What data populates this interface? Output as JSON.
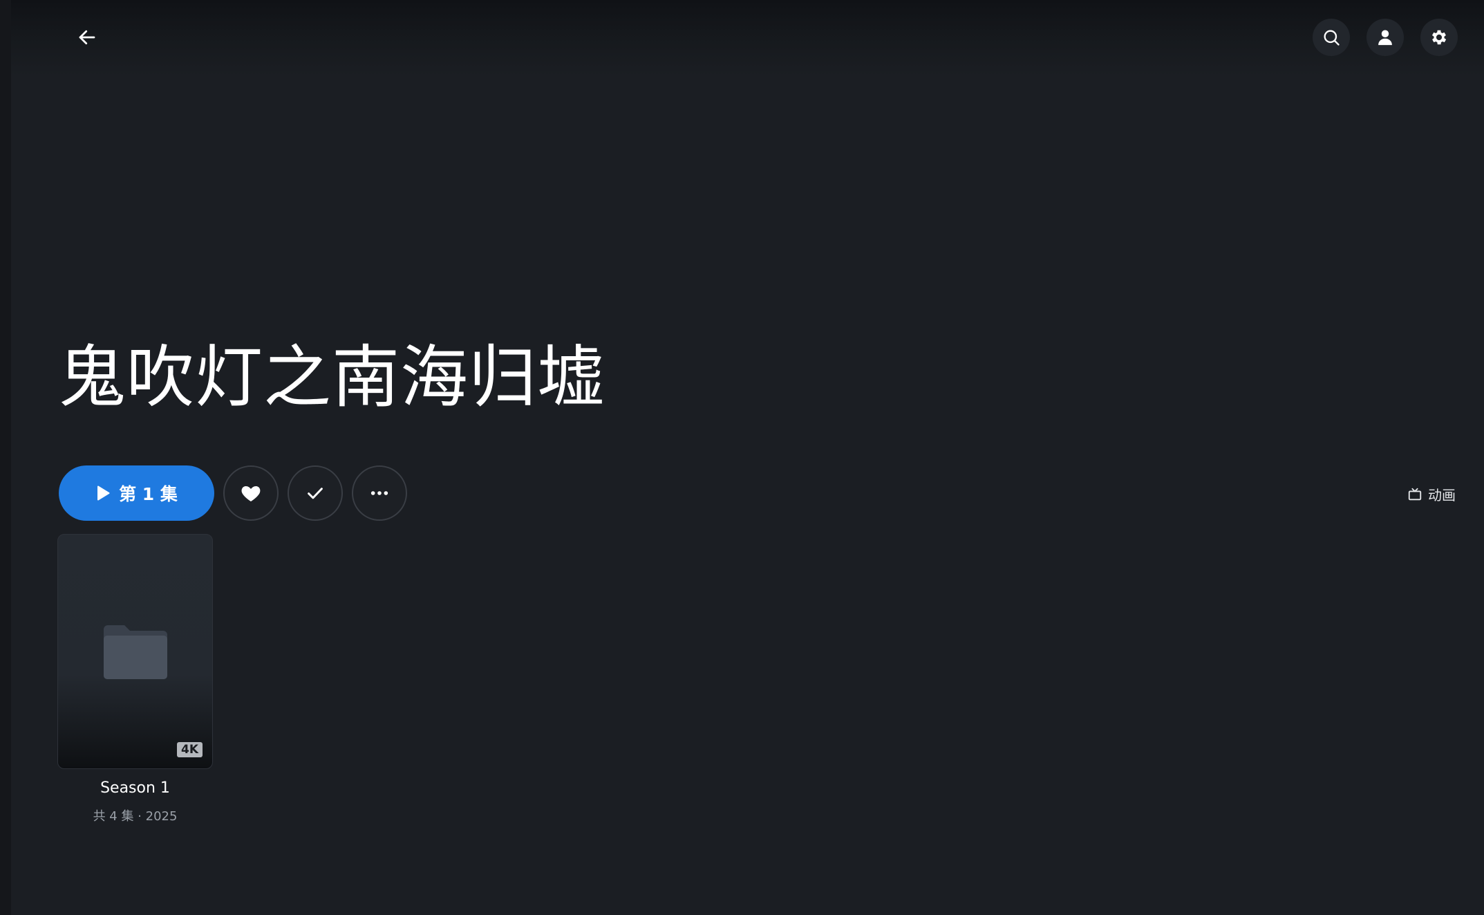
{
  "header": {
    "back_icon": "arrow-left-icon",
    "actions": [
      {
        "name": "search-button",
        "icon": "search-icon"
      },
      {
        "name": "user-button",
        "icon": "user-icon"
      },
      {
        "name": "settings-button",
        "icon": "gear-icon"
      }
    ]
  },
  "show": {
    "title": "鬼吹灯之南海归墟",
    "genre": "动画"
  },
  "actions": {
    "play_label": "第 1 集"
  },
  "seasons": [
    {
      "name": "Season 1",
      "meta": "共 4 集 · 2025",
      "badge": "4K",
      "icon": "folder-icon"
    }
  ],
  "colors": {
    "background": "#1b1e23",
    "accent": "#1f7ae0"
  }
}
